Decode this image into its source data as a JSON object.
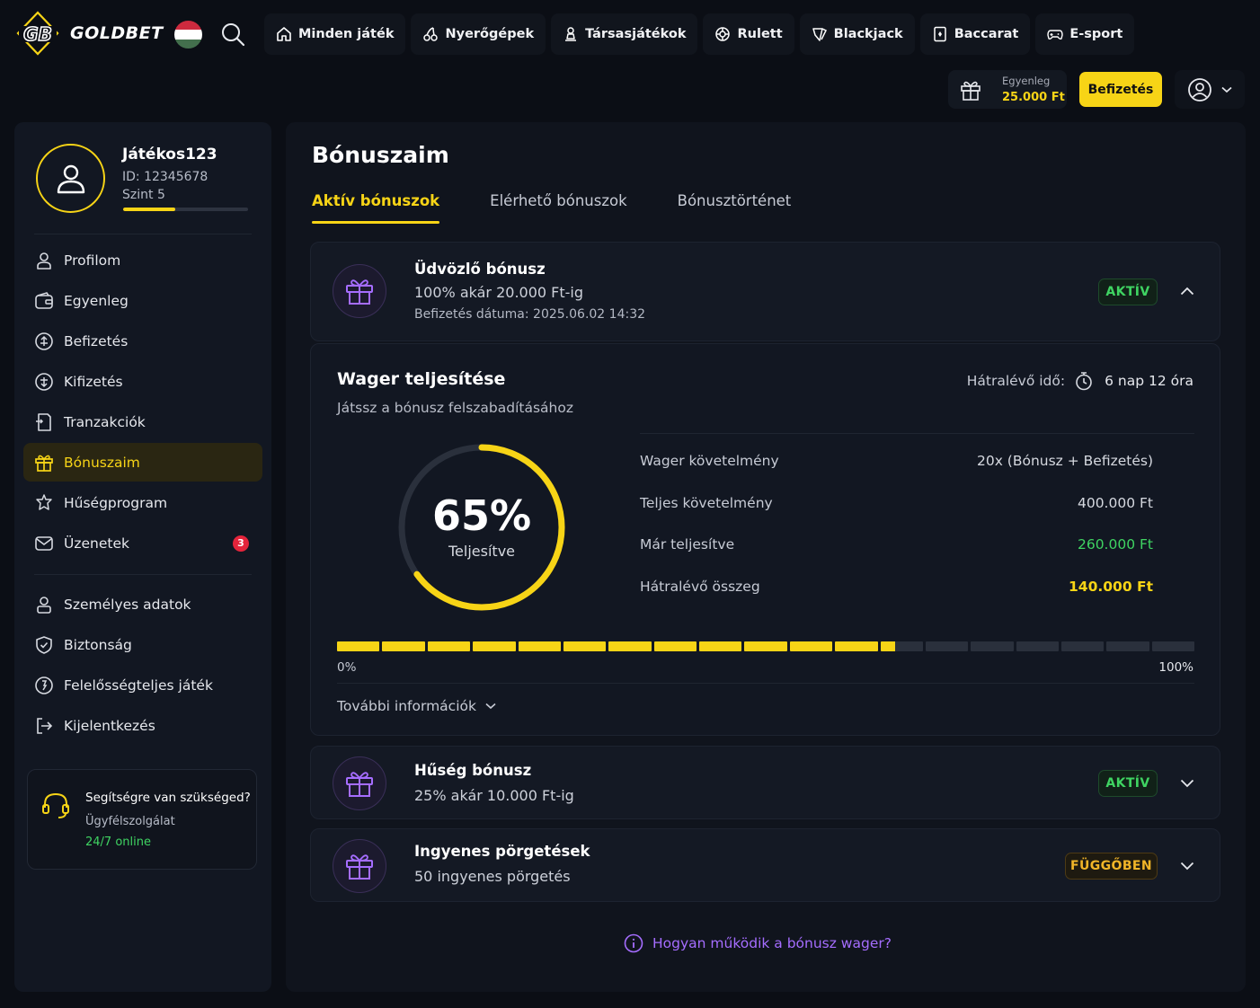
{
  "brand": {
    "logo_mark": "GB",
    "name": "GOLDBET"
  },
  "colors": {
    "accent": "#f7d416",
    "success": "#3fd462",
    "warning": "#f1b528",
    "purple": "#a56dff",
    "danger": "#e5243b",
    "background": "#0b0e15"
  },
  "nav": {
    "items": [
      {
        "label": "Minden játék",
        "icon": "home-icon"
      },
      {
        "label": "Nyerőgépek",
        "icon": "cherries-icon"
      },
      {
        "label": "Társasjátékok",
        "icon": "pawn-icon"
      },
      {
        "label": "Rulett",
        "icon": "roulette-icon"
      },
      {
        "label": "Blackjack",
        "icon": "cards-icon"
      },
      {
        "label": "Baccarat",
        "icon": "card-icon"
      },
      {
        "label": "E-sport",
        "icon": "gamepad-icon"
      }
    ]
  },
  "header": {
    "balance_label": "Egyenleg",
    "balance_value": "25.000 Ft",
    "deposit_label": "Befizetés"
  },
  "profile": {
    "username": "Játékos123",
    "id_text": "ID: 12345678",
    "level_text": "Szint 5",
    "level_progress": 0.42
  },
  "sidebar": {
    "items": [
      {
        "label": "Profilom",
        "icon": "user-icon"
      },
      {
        "label": "Egyenleg",
        "icon": "wallet-icon"
      },
      {
        "label": "Befizetés",
        "icon": "deposit-icon"
      },
      {
        "label": "Kifizetés",
        "icon": "withdraw-icon"
      },
      {
        "label": "Tranzakciók",
        "icon": "transactions-icon"
      },
      {
        "label": "Bónuszaim",
        "icon": "gift-icon",
        "active": true
      },
      {
        "label": "Hűségprogram",
        "icon": "loyalty-icon"
      },
      {
        "label": "Üzenetek",
        "icon": "mail-icon",
        "badge": "3"
      }
    ],
    "items2": [
      {
        "label": "Személyes adatok",
        "icon": "id-icon"
      },
      {
        "label": "Biztonság",
        "icon": "shield-icon"
      },
      {
        "label": "Felelősségteljes játék",
        "icon": "responsible-icon"
      },
      {
        "label": "Kijelentkezés",
        "icon": "logout-icon"
      }
    ],
    "help": {
      "title": "Segítségre van szükséged?",
      "subtitle": "Ügyfélszolgálat",
      "status": "24/7 online"
    }
  },
  "main": {
    "title": "Bónuszaim",
    "tabs": [
      {
        "label": "Aktív bónuszok",
        "active": true
      },
      {
        "label": "Elérhető bónuszok"
      },
      {
        "label": "Bónusztörténet"
      }
    ],
    "bonuses": [
      {
        "title": "Üdvözlő bónusz",
        "subtitle": "100% akár 20.000 Ft-ig",
        "date": "Befizetés dátuma: 2025.06.02 14:32",
        "status": "AKTÍV",
        "expanded": true
      },
      {
        "title": "Hűség bónusz",
        "subtitle": "25% akár 10.000 Ft-ig",
        "status": "AKTÍV",
        "expanded": false
      },
      {
        "title": "Ingyenes pörgetések",
        "subtitle": "50 ingyenes pörgetés",
        "status": "FÜGGŐBEN",
        "expanded": false
      }
    ],
    "wager": {
      "title": "Wager teljesítése",
      "subtitle": "Játssz a bónusz felszabadításához",
      "remaining_label": "Hátralévő idő:",
      "remaining_value": "6 nap 12 óra",
      "percent": 65,
      "percent_text": "65%",
      "ring_label": "Teljesítve",
      "rows": [
        {
          "label": "Wager követelmény",
          "value": "20x (Bónusz + Befizetés)",
          "tone": ""
        },
        {
          "label": "Teljes követelmény",
          "value": "400.000 Ft",
          "tone": ""
        },
        {
          "label": "Már teljesítve",
          "value": "260.000 Ft",
          "tone": "green"
        },
        {
          "label": "Hátralévő összeg",
          "value": "140.000 Ft",
          "tone": "yellow"
        }
      ],
      "bar_min": "0%",
      "bar_max": "100%",
      "more_info": "További információk"
    },
    "howto_link": "Hogyan működik a bónusz wager?"
  }
}
